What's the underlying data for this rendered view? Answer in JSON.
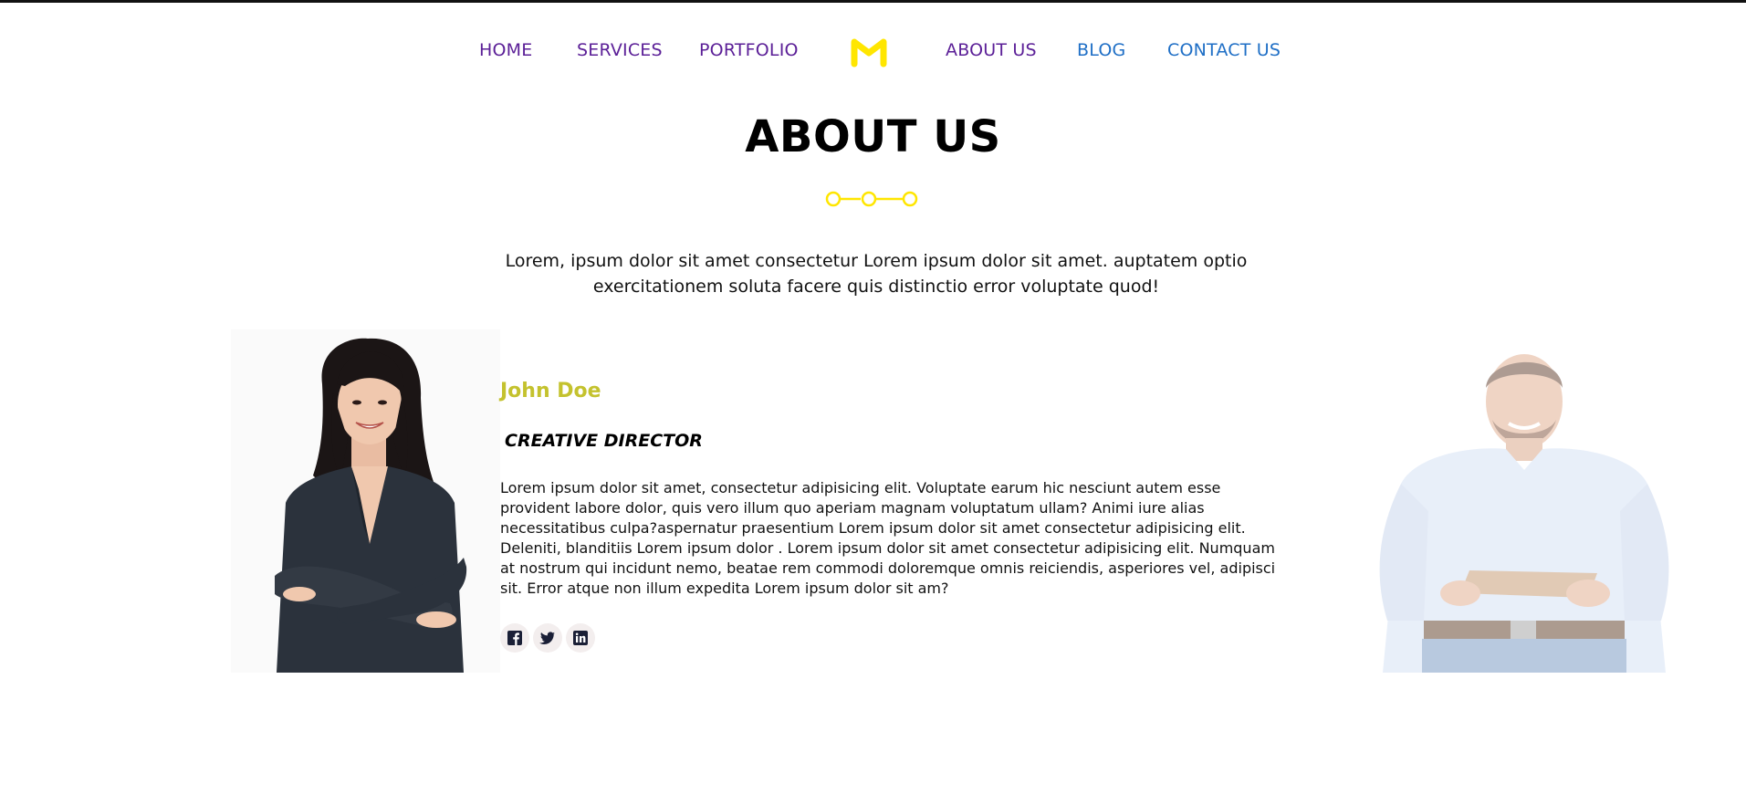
{
  "nav": {
    "items": [
      {
        "label": "HOME",
        "color": "#5b1f97"
      },
      {
        "label": "SERVICES",
        "color": "#5b1f97"
      },
      {
        "label": "PORTFOLIO",
        "color": "#5b1f97"
      },
      {
        "label": "ABOUT US",
        "color": "#5b1f97"
      },
      {
        "label": "BLOG",
        "color": "#1f6fc6"
      },
      {
        "label": "CONTACT US",
        "color": "#1f6fc6"
      }
    ],
    "logo_icon": "m-logo-icon",
    "logo_color": "#ffe600"
  },
  "section": {
    "title": "ABOUT US",
    "divider_icon": "three-circle-divider-icon",
    "accent_color": "#ffe600",
    "intro": "Lorem, ipsum dolor sit amet consectetur Lorem ipsum dolor sit amet. auptatem optio exercitationem soluta facere quis distinctio error voluptate quod!"
  },
  "profile": {
    "name": "John Doe",
    "name_color": "#c4c22e",
    "role": "CREATIVE DIRECTOR",
    "bio": "Lorem ipsum dolor sit amet, consectetur adipisicing elit. Voluptate earum hic nesciunt autem esse provident labore dolor, quis vero illum quo aperiam magnam voluptatum ullam? Animi iure alias necessitatibus culpa?aspernatur praesentium Lorem ipsum dolor sit amet consectetur adipisicing elit. Deleniti, blanditiis Lorem ipsum dolor . Lorem ipsum dolor sit amet consectetur adipisicing elit. Numquam at nostrum qui incidunt nemo, beatae rem commodi doloremque omnis reiciendis, asperiores vel, adipisci sit. Error atque non illum expedita Lorem ipsum dolor sit am?",
    "socials": [
      "facebook-icon",
      "twitter-icon",
      "linkedin-icon"
    ]
  }
}
